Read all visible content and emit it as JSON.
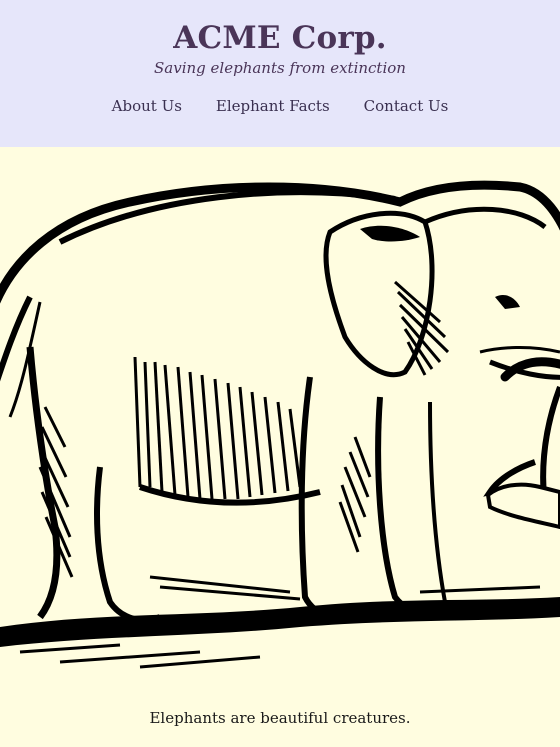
{
  "header": {
    "title": "ACME Corp.",
    "tagline": "Saving elephants from extinction",
    "nav": [
      {
        "label": "About Us"
      },
      {
        "label": "Elephant Facts"
      },
      {
        "label": "Contact Us"
      }
    ],
    "background_color": "#e6e6fa",
    "title_color": "#4a3558"
  },
  "hero": {
    "image": "elephant-illustration"
  },
  "main": {
    "caption": "Elephants are beautiful creatures."
  },
  "page": {
    "background_color": "#fffde0"
  }
}
